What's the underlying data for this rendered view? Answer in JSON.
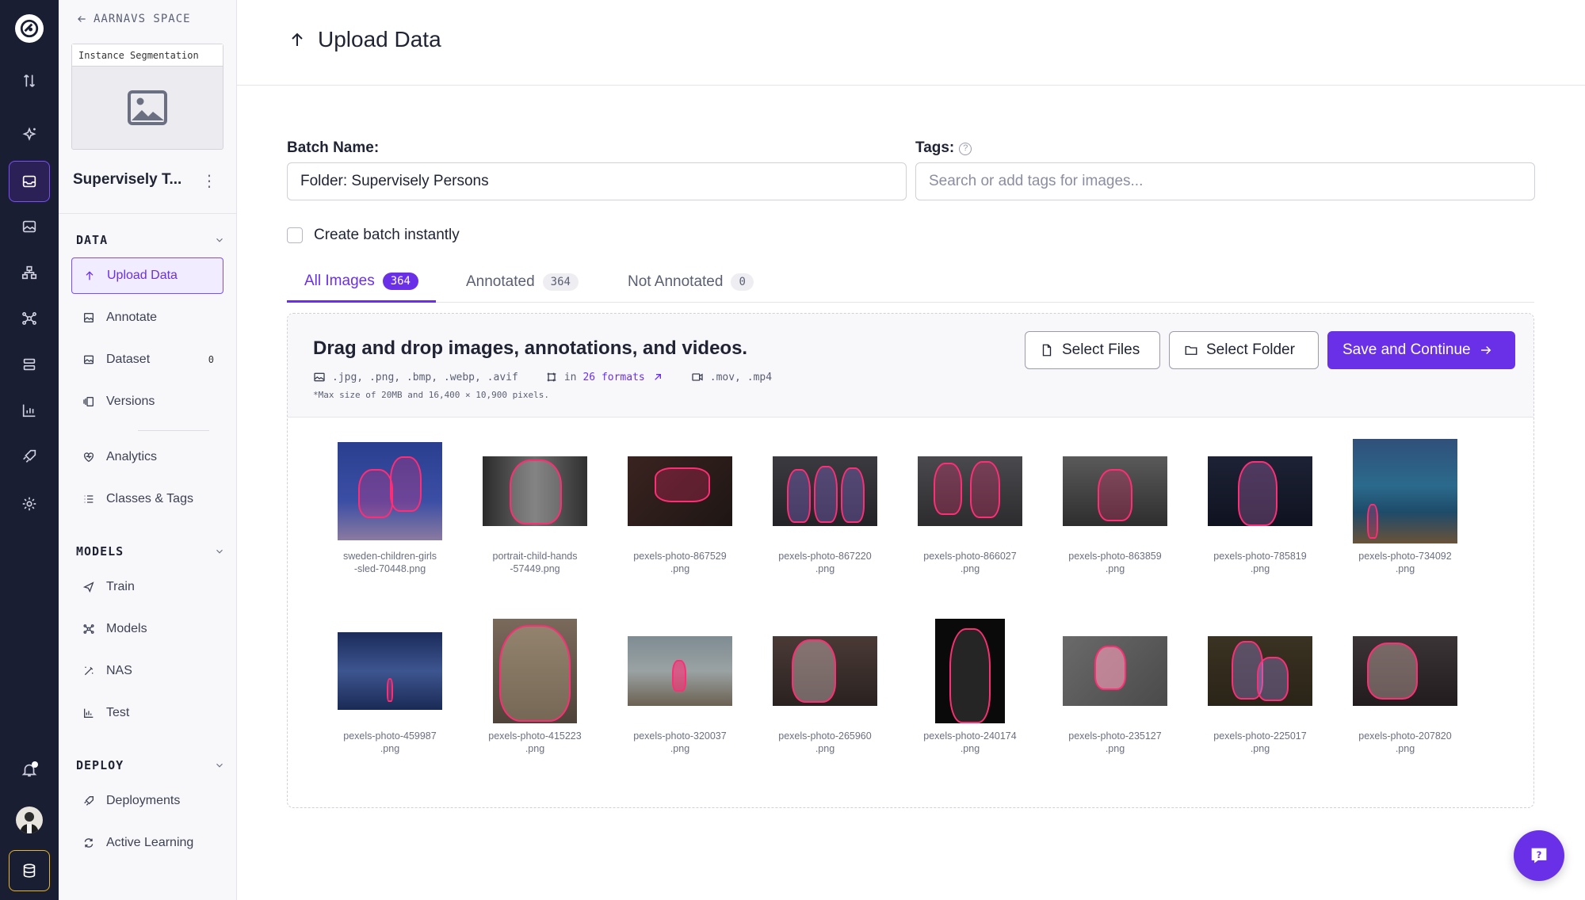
{
  "sidebar": {
    "back_label": "AARNAVS SPACE",
    "project_type": "Instance Segmentation",
    "project_name": "Supervisely T...",
    "sections": {
      "data": "DATA",
      "models": "MODELS",
      "deploy": "DEPLOY"
    },
    "items": {
      "upload": "Upload Data",
      "annotate": "Annotate",
      "dataset": "Dataset",
      "dataset_badge": "0",
      "versions": "Versions",
      "analytics": "Analytics",
      "classes": "Classes & Tags",
      "train": "Train",
      "models": "Models",
      "nas": "NAS",
      "test": "Test",
      "deployments": "Deployments",
      "active_learning": "Active Learning"
    }
  },
  "header": {
    "title": "Upload Data"
  },
  "form": {
    "batch_label": "Batch Name:",
    "batch_value": "Folder: Supervisely Persons",
    "tags_label": "Tags:",
    "tags_help": "?",
    "tags_placeholder": "Search or add tags for images...",
    "instant_label": "Create batch instantly"
  },
  "tabs": [
    {
      "label": "All Images",
      "count": "364"
    },
    {
      "label": "Annotated",
      "count": "364"
    },
    {
      "label": "Not Annotated",
      "count": "0"
    }
  ],
  "dropzone": {
    "title": "Drag and drop images, annotations, and videos.",
    "image_formats": ".jpg, .png, .bmp, .webp, .avif",
    "annot_prefix": "in",
    "annot_link": "26 formats",
    "video_formats": ".mov, .mp4",
    "max_note": "*Max size of 20MB and 16,400 × 10,900 pixels.",
    "select_files": "Select Files",
    "select_folder": "Select Folder",
    "save_continue": "Save and Continue"
  },
  "images": [
    {
      "name": "sweden-children-girls\n-sled-70448.png"
    },
    {
      "name": "portrait-child-hands\n-57449.png"
    },
    {
      "name": "pexels-photo-867529\n.png"
    },
    {
      "name": "pexels-photo-867220\n.png"
    },
    {
      "name": "pexels-photo-866027\n.png"
    },
    {
      "name": "pexels-photo-863859\n.png"
    },
    {
      "name": "pexels-photo-785819\n.png"
    },
    {
      "name": "pexels-photo-734092\n.png"
    },
    {
      "name": "pexels-photo-459987\n.png"
    },
    {
      "name": "pexels-photo-415223\n.png"
    },
    {
      "name": "pexels-photo-320037\n.png"
    },
    {
      "name": "pexels-photo-265960\n.png"
    },
    {
      "name": "pexels-photo-240174\n.png"
    },
    {
      "name": "pexels-photo-235127\n.png"
    },
    {
      "name": "pexels-photo-225017\n.png"
    },
    {
      "name": "pexels-photo-207820\n.png"
    }
  ],
  "colors": {
    "accent": "#6a30e8",
    "rail_bg": "#1a1e33",
    "mask": "#ff2d75"
  }
}
